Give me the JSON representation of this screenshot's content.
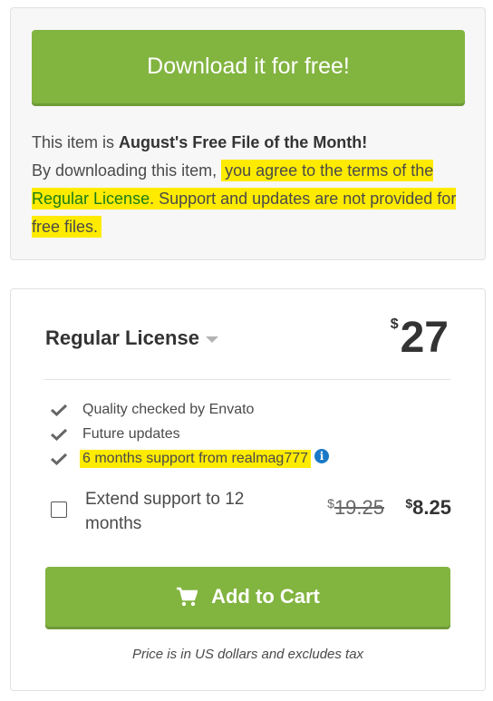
{
  "free_card": {
    "download_label": "Download it for free!",
    "intro": "This item is ",
    "highlight": "August's Free File of the Month!",
    "by_downloading": "By downloading this item, ",
    "agree_text": "you agree to the terms of the ",
    "license_link": "Regular License",
    "support_text": ". Support and updates are not provided for free files."
  },
  "license": {
    "title": "Regular License",
    "currency": "$",
    "price": "27",
    "features": [
      "Quality checked by Envato",
      "Future updates",
      "6 months support from realmag777"
    ],
    "extend_label": "Extend support to 12 months",
    "old_price_currency": "$",
    "old_price": "19.25",
    "new_price_currency": "$",
    "new_price": "8.25",
    "add_to_cart_label": "Add to Cart",
    "footnote": "Price is in US dollars and excludes tax"
  },
  "colors": {
    "button_green": "#82b440",
    "highlight_yellow": "#ffeb00",
    "link_green": "#197d19",
    "info_blue": "#1b7ac7"
  },
  "icons": [
    "check-icon",
    "info-icon",
    "cart-icon",
    "caret-down-icon"
  ]
}
